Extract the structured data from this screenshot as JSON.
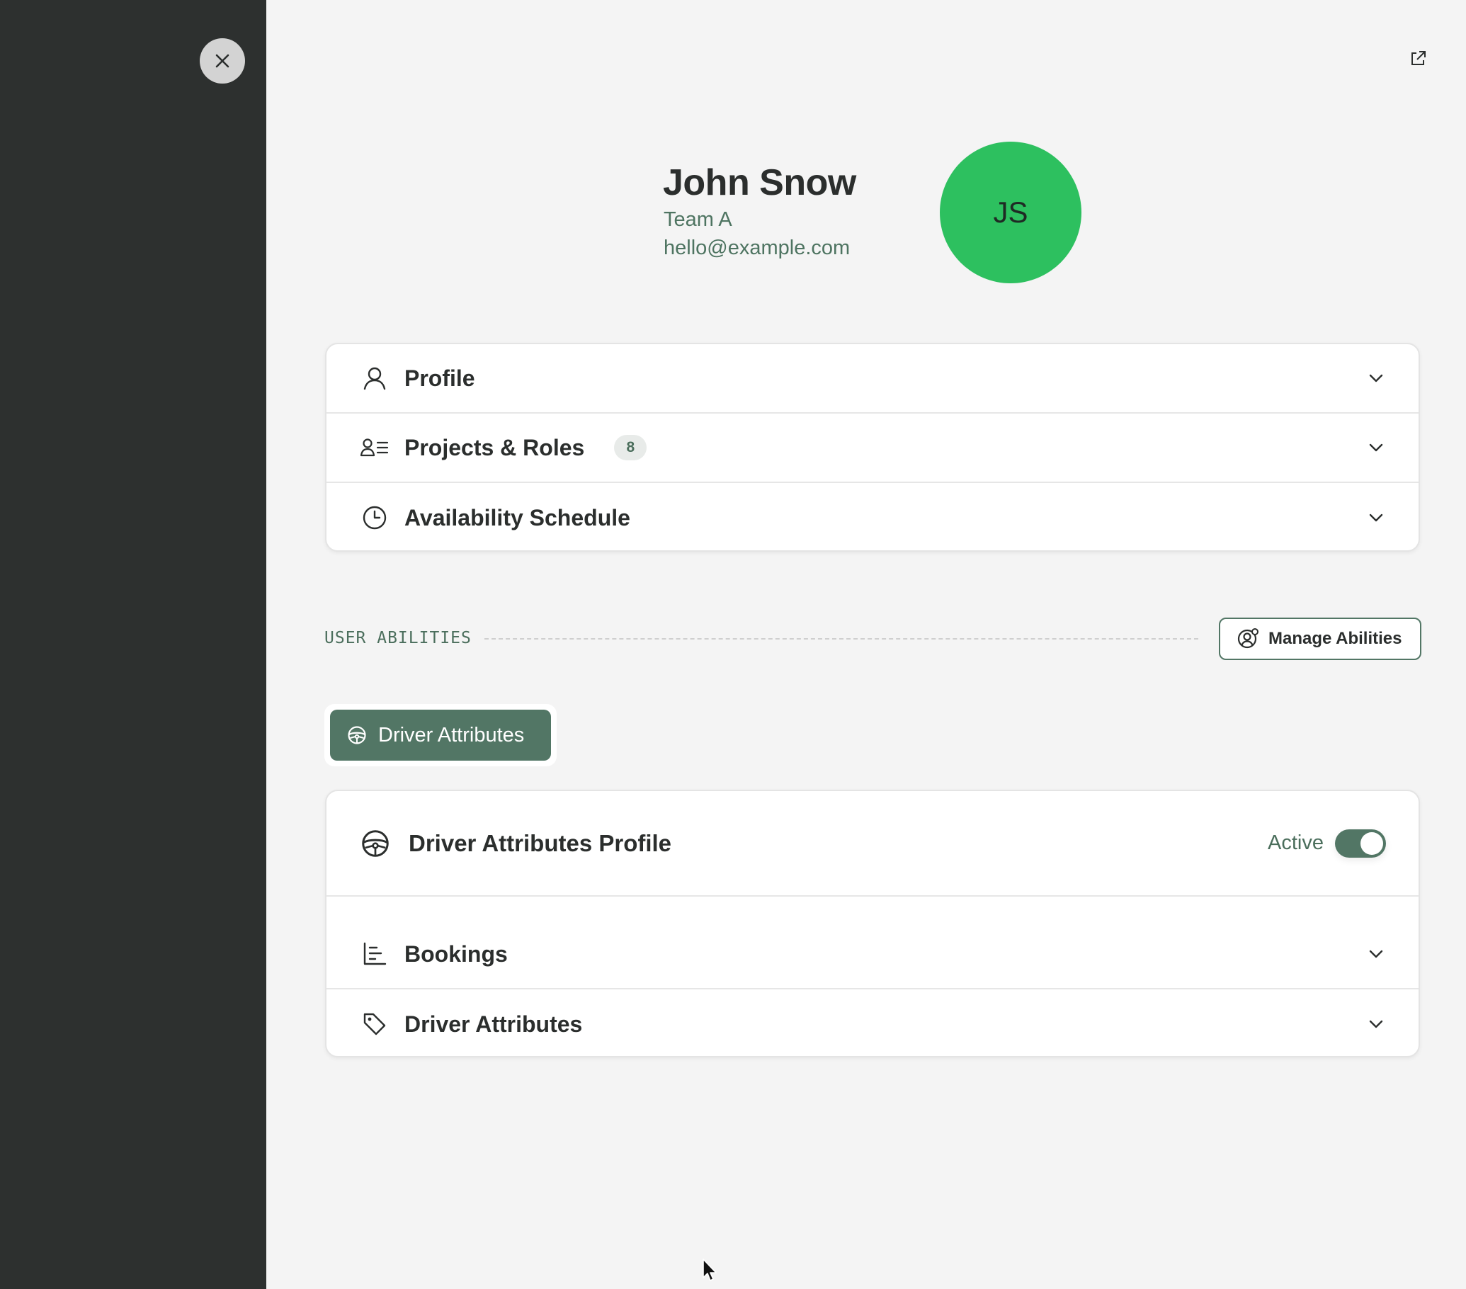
{
  "backdrop": {
    "close_icon": "close-icon"
  },
  "header": {
    "external_link_icon": "external-link-icon",
    "name": "John Snow",
    "team": "Team A",
    "email": "hello@example.com",
    "avatar_initials": "JS",
    "avatar_color": "#2dc05f"
  },
  "accordion": {
    "items": [
      {
        "label": "Profile",
        "icon": "user-icon"
      },
      {
        "label": "Projects & Roles",
        "icon": "user-list-icon",
        "badge": "8"
      },
      {
        "label": "Availability Schedule",
        "icon": "clock-icon"
      }
    ]
  },
  "abilities": {
    "section_title": "USER ABILITIES",
    "manage_button_label": "Manage Abilities",
    "manage_button_icon": "user-settings-icon",
    "tabs": [
      {
        "label": "Driver Attributes",
        "icon": "steering-wheel-icon",
        "selected": true
      }
    ]
  },
  "driver_profile": {
    "title": "Driver Attributes Profile",
    "icon": "steering-wheel-icon",
    "status_label": "Active",
    "active": true,
    "sections": [
      {
        "label": "Bookings",
        "icon": "chart-list-icon"
      },
      {
        "label": "Driver Attributes",
        "icon": "tag-icon"
      }
    ]
  },
  "colors": {
    "accent": "#527665",
    "backdrop": "#2d302f",
    "panel": "#f4f4f4",
    "muted_text": "#4e7461"
  }
}
